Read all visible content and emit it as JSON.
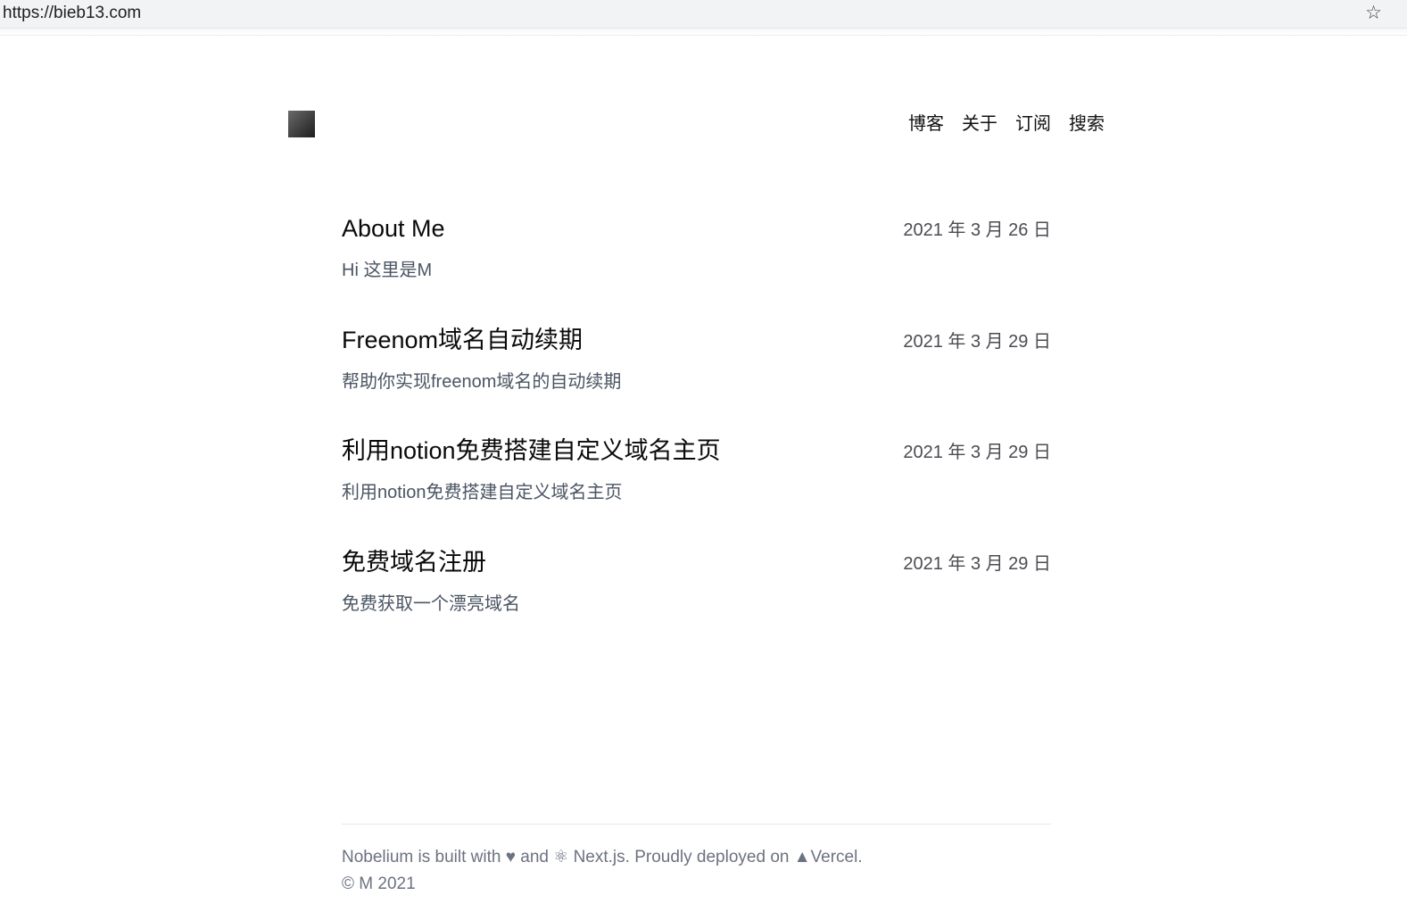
{
  "browser": {
    "url": "https://bieb13.com",
    "bookmark_icon": "☆"
  },
  "header": {
    "nav": [
      {
        "label": "博客"
      },
      {
        "label": "关于"
      },
      {
        "label": "订阅"
      },
      {
        "label": "搜索"
      }
    ]
  },
  "posts": [
    {
      "title": "About Me",
      "date": "2021 年 3 月 26 日",
      "summary": "Hi 这里是M"
    },
    {
      "title": "Freenom域名自动续期",
      "date": "2021 年 3 月 29 日",
      "summary": "帮助你实现freenom域名的自动续期"
    },
    {
      "title": "利用notion免费搭建自定义域名主页",
      "date": "2021 年 3 月 29 日",
      "summary": "利用notion免费搭建自定义域名主页"
    },
    {
      "title": "免费域名注册",
      "date": "2021 年 3 月 29 日",
      "summary": "免费获取一个漂亮域名"
    }
  ],
  "footer": {
    "credit": "Nobelium is built with ♥ and ⚛ Next.js. Proudly deployed on ▲Vercel.",
    "copyright": "© M 2021"
  }
}
